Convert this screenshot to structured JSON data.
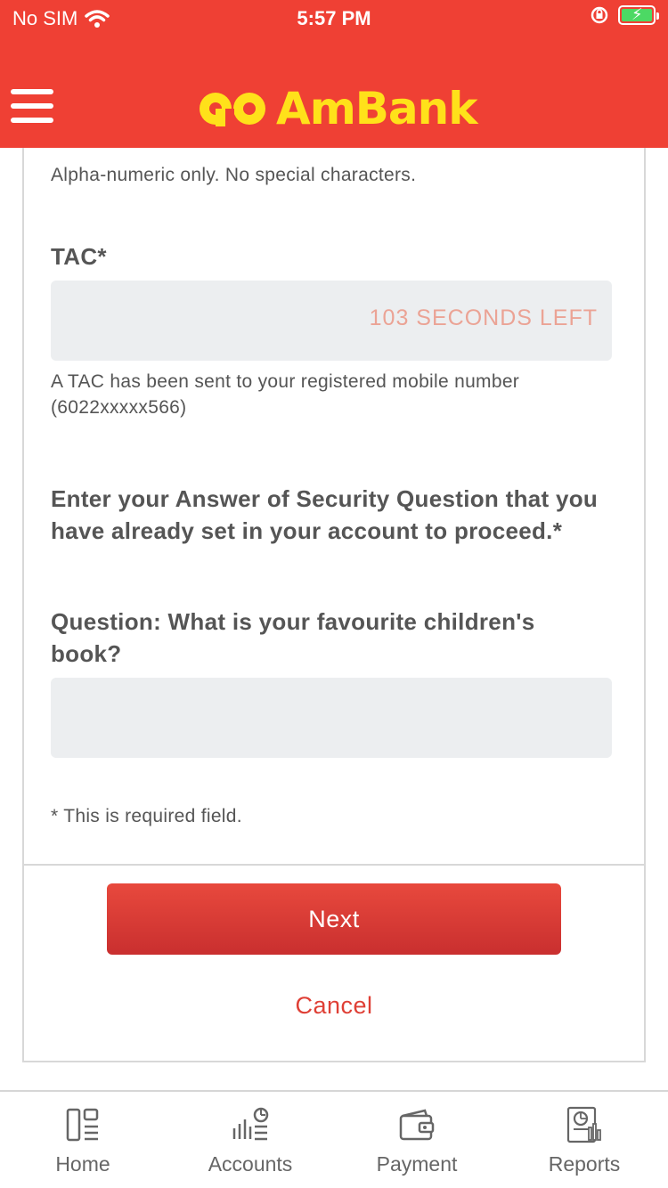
{
  "status_bar": {
    "carrier": "No SIM",
    "time": "5:57 PM"
  },
  "header": {
    "brand": "AmBank",
    "brand_color": "#ffe11a",
    "background_color": "#ef4034"
  },
  "form": {
    "username_hint": "Alpha-numeric only. No special characters.",
    "tac_label": "TAC*",
    "tac_countdown": "103 SECONDS LEFT",
    "tac_value": "",
    "tac_hint": "A TAC has been sent to your registered mobile number (6022xxxxx566)",
    "security_intro": "Enter your Answer of Security Question that you have already set in your account to proceed.*",
    "security_question": "Question: What is your favourite children's book?",
    "security_answer_value": "",
    "required_note": "* This is required field."
  },
  "actions": {
    "next_label": "Next",
    "cancel_label": "Cancel",
    "accent_color": "#df3f35"
  },
  "tabbar": {
    "items": [
      {
        "label": "Home",
        "icon": "home-icon"
      },
      {
        "label": "Accounts",
        "icon": "accounts-icon"
      },
      {
        "label": "Payment",
        "icon": "wallet-icon"
      },
      {
        "label": "Reports",
        "icon": "reports-icon"
      }
    ]
  }
}
